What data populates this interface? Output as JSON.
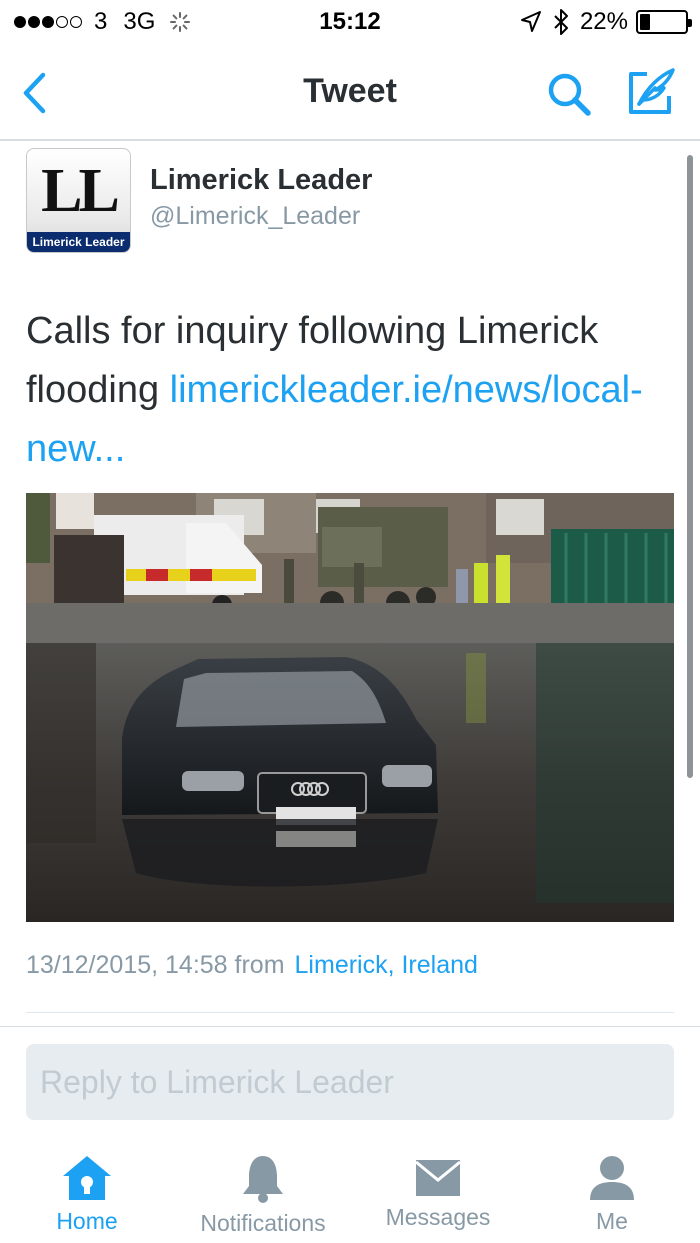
{
  "status_bar": {
    "carrier": "3",
    "network": "3G",
    "time": "15:12",
    "battery": "22%",
    "battery_level": 0.22
  },
  "nav": {
    "title": "Tweet",
    "back_icon": "chevron-left-icon",
    "search_icon": "search-icon",
    "compose_icon": "compose-tweet-icon"
  },
  "tweet": {
    "author_name": "Limerick Leader",
    "author_handle": "@Limerick_Leader",
    "avatar_text": "LL",
    "avatar_caption": "Limerick Leader",
    "text": "Calls for inquiry following Limerick flooding ",
    "link": "limerickleader.ie/news/local-new...",
    "timestamp": "13/12/2015, 14:58 from",
    "location": "Limerick, Ireland"
  },
  "reply": {
    "placeholder": "Reply to Limerick Leader"
  },
  "tabs": [
    {
      "label": "Home",
      "icon": "home-icon",
      "active": true
    },
    {
      "label": "Notifications",
      "icon": "bell-icon",
      "active": false
    },
    {
      "label": "Messages",
      "icon": "envelope-icon",
      "active": false
    },
    {
      "label": "Me",
      "icon": "person-icon",
      "active": false
    }
  ],
  "colors": {
    "accent": "#1da1f2",
    "text": "#292f33",
    "muted": "#8899a6"
  }
}
